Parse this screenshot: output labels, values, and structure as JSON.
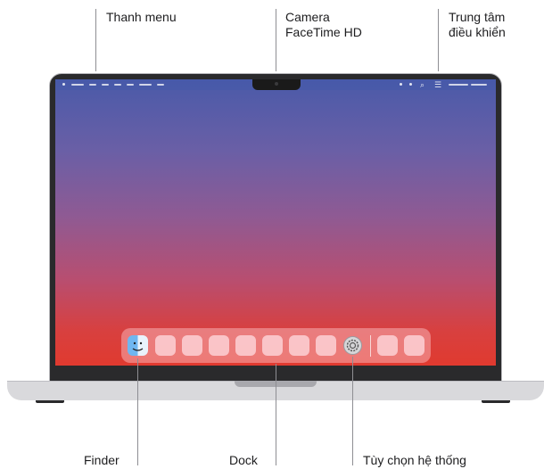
{
  "labels": {
    "menu_bar": "Thanh menu",
    "camera_line1": "Camera",
    "camera_line2": "FaceTime HD",
    "control_center_line1": "Trung tâm",
    "control_center_line2": "điều khiển",
    "finder": "Finder",
    "dock": "Dock",
    "system_settings": "Tùy chọn hệ thống"
  },
  "icons": {
    "finder": "finder-icon",
    "system_settings": "gear-icon",
    "search": "search-icon",
    "control_center": "control-center-icon"
  },
  "colors": {
    "wallpaper_top": "#4a5aa9",
    "wallpaper_bottom": "#e03a2f",
    "leader_line": "#8e8e93"
  }
}
